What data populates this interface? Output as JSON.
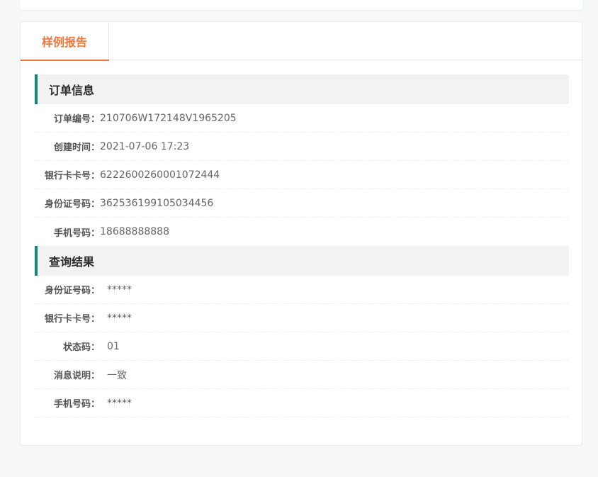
{
  "tabs": [
    {
      "label": "样例报告",
      "active": true
    }
  ],
  "colors": {
    "accent": "#f0773a",
    "section_bar": "#0f8a7a"
  },
  "order_info": {
    "title": "订单信息",
    "rows": [
      {
        "label": "订单编号：",
        "value": "210706W172148V1965205"
      },
      {
        "label": "创建时间：",
        "value": "2021-07-06 17:23"
      },
      {
        "label": "银行卡卡号：",
        "value": "6222600260001072444"
      },
      {
        "label": "身份证号码：",
        "value": "362536199105034456"
      },
      {
        "label": "手机号码：",
        "value": "18688888888"
      }
    ]
  },
  "query_result": {
    "title": "查询结果",
    "rows": [
      {
        "label": "身份证号码：",
        "value": "*****"
      },
      {
        "label": "银行卡卡号：",
        "value": "*****"
      },
      {
        "label": "状态码：",
        "value": "01"
      },
      {
        "label": "消息说明：",
        "value": "一致"
      },
      {
        "label": "手机号码：",
        "value": "*****"
      }
    ]
  }
}
